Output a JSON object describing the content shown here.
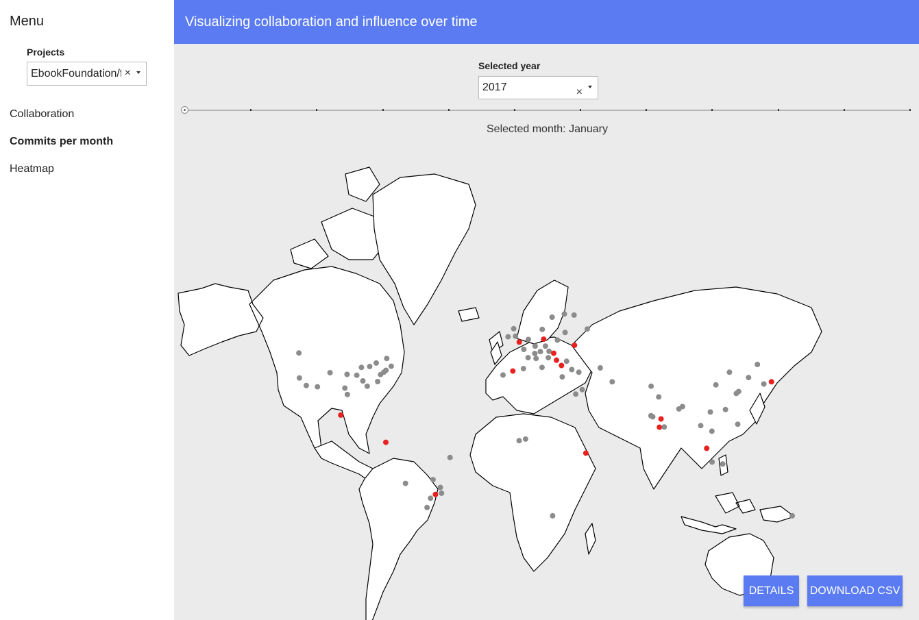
{
  "sidebar": {
    "menu_title": "Menu",
    "projects_label": "Projects",
    "project_value": "EbookFoundation/free-programming-books",
    "clear_glyph": "×",
    "items": [
      {
        "label": "Collaboration",
        "active": false
      },
      {
        "label": "Commits per month",
        "active": true
      },
      {
        "label": "Heatmap",
        "active": false
      }
    ]
  },
  "header": {
    "title": "Visualizing collaboration and influence over time",
    "color": "#5a7bf2"
  },
  "controls": {
    "year_label": "Selected year",
    "year_value": "2017",
    "clear_glyph": "×",
    "month_slider": {
      "months": 12,
      "selected_index": 0
    },
    "month_label": "Selected month:",
    "month_value": "January"
  },
  "map": {
    "background": "#ebebeb",
    "land_color": "#ffffff",
    "border_color": "#000000",
    "dot_colors": {
      "gray": "#8c8c8c",
      "red": "#e8211f"
    },
    "locations": [
      {
        "lat": 37.4,
        "lon": -122.0,
        "color": "gray"
      },
      {
        "lat": 34.0,
        "lon": -118.2,
        "color": "gray"
      },
      {
        "lat": 33.4,
        "lon": -112.0,
        "color": "gray"
      },
      {
        "lat": 39.7,
        "lon": -105.0,
        "color": "gray"
      },
      {
        "lat": 39.0,
        "lon": -95.6,
        "color": "gray"
      },
      {
        "lat": 38.6,
        "lon": -90.2,
        "color": "gray"
      },
      {
        "lat": 36.1,
        "lon": -86.8,
        "color": "gray"
      },
      {
        "lat": 41.9,
        "lon": -87.6,
        "color": "gray"
      },
      {
        "lat": 42.3,
        "lon": -83.0,
        "color": "gray"
      },
      {
        "lat": 39.9,
        "lon": -75.2,
        "color": "gray"
      },
      {
        "lat": 40.7,
        "lon": -74.0,
        "color": "gray"
      },
      {
        "lat": 42.4,
        "lon": -71.1,
        "color": "gray"
      },
      {
        "lat": 43.7,
        "lon": -79.4,
        "color": "gray"
      },
      {
        "lat": 45.5,
        "lon": -73.6,
        "color": "gray"
      },
      {
        "lat": 38.9,
        "lon": -77.0,
        "color": "gray"
      },
      {
        "lat": 35.8,
        "lon": -78.6,
        "color": "gray"
      },
      {
        "lat": 32.8,
        "lon": -96.8,
        "color": "gray"
      },
      {
        "lat": 29.8,
        "lon": -95.4,
        "color": "gray"
      },
      {
        "lat": 33.7,
        "lon": -84.4,
        "color": "gray"
      },
      {
        "lat": 47.6,
        "lon": -122.3,
        "color": "gray"
      },
      {
        "lat": 19.4,
        "lon": -99.1,
        "color": "red"
      },
      {
        "lat": 4.7,
        "lon": -74.1,
        "color": "red"
      },
      {
        "lat": -3.7,
        "lon": -38.5,
        "color": "gray"
      },
      {
        "lat": -15.8,
        "lon": -47.9,
        "color": "gray"
      },
      {
        "lat": -19.9,
        "lon": -43.9,
        "color": "gray"
      },
      {
        "lat": -22.9,
        "lon": -43.2,
        "color": "gray"
      },
      {
        "lat": -23.5,
        "lon": -46.6,
        "color": "red"
      },
      {
        "lat": -25.4,
        "lon": -49.3,
        "color": "gray"
      },
      {
        "lat": -30.0,
        "lon": -51.2,
        "color": "gray"
      },
      {
        "lat": -17.8,
        "lon": -63.2,
        "color": "gray"
      },
      {
        "lat": 51.5,
        "lon": -0.1,
        "color": "red"
      },
      {
        "lat": 53.5,
        "lon": -2.2,
        "color": "gray"
      },
      {
        "lat": 55.9,
        "lon": -3.2,
        "color": "gray"
      },
      {
        "lat": 53.3,
        "lon": -6.3,
        "color": "gray"
      },
      {
        "lat": 48.9,
        "lon": 2.4,
        "color": "gray"
      },
      {
        "lat": 45.8,
        "lon": 4.8,
        "color": "gray"
      },
      {
        "lat": 52.4,
        "lon": 4.9,
        "color": "gray"
      },
      {
        "lat": 52.5,
        "lon": 13.4,
        "color": "red"
      },
      {
        "lat": 48.1,
        "lon": 11.6,
        "color": "gray"
      },
      {
        "lat": 50.1,
        "lon": 8.7,
        "color": "gray"
      },
      {
        "lat": 47.4,
        "lon": 8.5,
        "color": "gray"
      },
      {
        "lat": 48.2,
        "lon": 16.4,
        "color": "gray"
      },
      {
        "lat": 50.1,
        "lon": 14.4,
        "color": "gray"
      },
      {
        "lat": 52.2,
        "lon": 21.0,
        "color": "gray"
      },
      {
        "lat": 47.5,
        "lon": 19.0,
        "color": "red"
      },
      {
        "lat": 44.8,
        "lon": 20.5,
        "color": "red"
      },
      {
        "lat": 45.8,
        "lon": 16.0,
        "color": "gray"
      },
      {
        "lat": 41.9,
        "lon": 12.5,
        "color": "gray"
      },
      {
        "lat": 45.5,
        "lon": 9.2,
        "color": "gray"
      },
      {
        "lat": 40.4,
        "lon": -3.7,
        "color": "red"
      },
      {
        "lat": 41.4,
        "lon": 2.2,
        "color": "gray"
      },
      {
        "lat": 38.7,
        "lon": -9.1,
        "color": "gray"
      },
      {
        "lat": 42.7,
        "lon": 23.3,
        "color": "red"
      },
      {
        "lat": 44.4,
        "lon": 26.1,
        "color": "gray"
      },
      {
        "lat": 41.0,
        "lon": 29.0,
        "color": "gray"
      },
      {
        "lat": 39.9,
        "lon": 32.9,
        "color": "gray"
      },
      {
        "lat": 37.9,
        "lon": 23.7,
        "color": "gray"
      },
      {
        "lat": 50.4,
        "lon": 30.5,
        "color": "red"
      },
      {
        "lat": 55.8,
        "lon": 37.6,
        "color": "gray"
      },
      {
        "lat": 59.9,
        "lon": 30.3,
        "color": "gray"
      },
      {
        "lat": 59.3,
        "lon": 18.1,
        "color": "gray"
      },
      {
        "lat": 60.2,
        "lon": 24.9,
        "color": "gray"
      },
      {
        "lat": 55.7,
        "lon": 12.6,
        "color": "gray"
      },
      {
        "lat": 54.7,
        "lon": 25.3,
        "color": "gray"
      },
      {
        "lat": 41.7,
        "lon": 44.8,
        "color": "gray"
      },
      {
        "lat": 32.1,
        "lon": 34.8,
        "color": "gray"
      },
      {
        "lat": 30.0,
        "lon": 31.2,
        "color": "gray"
      },
      {
        "lat": 35.7,
        "lon": 51.4,
        "color": "gray"
      },
      {
        "lat": 33.7,
        "lon": 73.0,
        "color": "gray"
      },
      {
        "lat": 28.6,
        "lon": 77.2,
        "color": "gray"
      },
      {
        "lat": 19.1,
        "lon": 72.9,
        "color": "gray"
      },
      {
        "lat": 18.5,
        "lon": 73.9,
        "color": "gray"
      },
      {
        "lat": 17.4,
        "lon": 78.5,
        "color": "red"
      },
      {
        "lat": 12.97,
        "lon": 77.6,
        "color": "red"
      },
      {
        "lat": 13.1,
        "lon": 80.3,
        "color": "gray"
      },
      {
        "lat": 22.6,
        "lon": 88.4,
        "color": "gray"
      },
      {
        "lat": 23.8,
        "lon": 90.4,
        "color": "gray"
      },
      {
        "lat": 13.8,
        "lon": 100.5,
        "color": "gray"
      },
      {
        "lat": 21.0,
        "lon": 105.8,
        "color": "gray"
      },
      {
        "lat": 10.8,
        "lon": 106.7,
        "color": "gray"
      },
      {
        "lat": 1.35,
        "lon": 103.8,
        "color": "red"
      },
      {
        "lat": -6.2,
        "lon": 106.8,
        "color": "gray"
      },
      {
        "lat": -7.3,
        "lon": 112.7,
        "color": "gray"
      },
      {
        "lat": 14.6,
        "lon": 121.0,
        "color": "gray"
      },
      {
        "lat": 22.3,
        "lon": 114.2,
        "color": "gray"
      },
      {
        "lat": 31.2,
        "lon": 121.5,
        "color": "gray"
      },
      {
        "lat": 30.3,
        "lon": 120.2,
        "color": "gray"
      },
      {
        "lat": 39.9,
        "lon": 116.4,
        "color": "gray"
      },
      {
        "lat": 34.3,
        "lon": 108.9,
        "color": "gray"
      },
      {
        "lat": 37.6,
        "lon": 127.0,
        "color": "gray"
      },
      {
        "lat": 35.7,
        "lon": 139.7,
        "color": "red"
      },
      {
        "lat": 34.7,
        "lon": 135.5,
        "color": "gray"
      },
      {
        "lat": 43.1,
        "lon": 131.9,
        "color": "gray"
      },
      {
        "lat": -33.9,
        "lon": 151.2,
        "color": "gray"
      },
      {
        "lat": -1.3,
        "lon": 36.8,
        "color": "red"
      },
      {
        "lat": 6.5,
        "lon": 3.4,
        "color": "gray"
      },
      {
        "lat": 5.6,
        "lon": -0.2,
        "color": "gray"
      },
      {
        "lat": -33.9,
        "lon": 18.4,
        "color": "gray"
      }
    ]
  },
  "buttons": {
    "details": "DETAILS",
    "download": "DOWNLOAD CSV"
  }
}
